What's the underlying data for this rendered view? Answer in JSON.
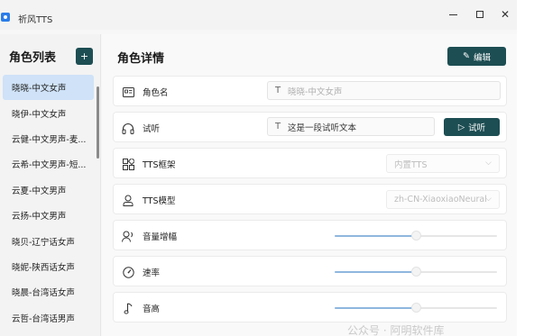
{
  "window": {
    "title": "祈风TTS"
  },
  "sidebar": {
    "title": "角色列表",
    "add_label": "+",
    "items": [
      {
        "label": "晓晓-中文女声",
        "selected": true
      },
      {
        "label": "晓伊-中文女声"
      },
      {
        "label": "云健-中文男声-麦..."
      },
      {
        "label": "云希-中文男声-短..."
      },
      {
        "label": "云夏-中文男声"
      },
      {
        "label": "云扬-中文男声"
      },
      {
        "label": "晓贝-辽宁话女声"
      },
      {
        "label": "晓妮-陕西话女声"
      },
      {
        "label": "晓晨-台湾话女声"
      },
      {
        "label": "云哲-台湾话男声"
      }
    ]
  },
  "main": {
    "title": "角色详情",
    "edit_label": "编辑",
    "fields": {
      "name": {
        "label": "角色名",
        "value": "晓晓-中文女声"
      },
      "preview": {
        "label": "试听",
        "value": "这是一段试听文本",
        "button": "试听"
      },
      "framework": {
        "label": "TTS框架",
        "value": "内置TTS"
      },
      "model": {
        "label": "TTS模型",
        "value": "zh-CN-XiaoxiaoNeural"
      },
      "volume": {
        "label": "音量增幅",
        "level": 0.5
      },
      "rate": {
        "label": "速率",
        "level": 0.5
      },
      "pitch": {
        "label": "音高",
        "level": 0.5
      }
    }
  },
  "watermark": "公众号 · 阿明软件库",
  "colors": {
    "accent": "#1d4e53",
    "selected_bg": "#cfe2f7",
    "slider_fill": "#8fb7de"
  }
}
